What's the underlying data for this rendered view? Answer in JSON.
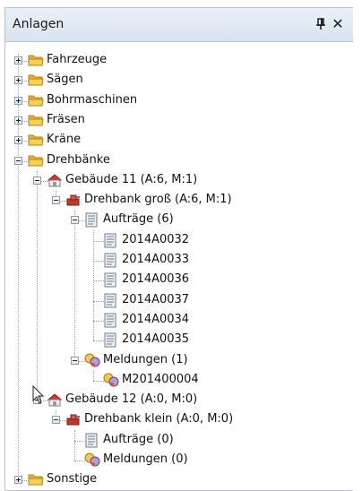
{
  "panel": {
    "title": "Anlagen",
    "pin_icon": "pin-icon",
    "close_icon": "close-icon"
  },
  "tree": {
    "nodes": [
      {
        "label": "Fahrzeuge",
        "type": "folder",
        "expanded": false
      },
      {
        "label": "Sägen",
        "type": "folder",
        "expanded": false
      },
      {
        "label": "Bohrmaschinen",
        "type": "folder",
        "expanded": false
      },
      {
        "label": "Fräsen",
        "type": "folder",
        "expanded": false
      },
      {
        "label": "Kräne",
        "type": "folder",
        "expanded": false
      },
      {
        "label": "Drehbänke",
        "type": "folder",
        "expanded": true
      },
      {
        "label": "Gebäude 11 (A:6, M:1)",
        "type": "building",
        "expanded": true
      },
      {
        "label": "Drehbank groß (A:6, M:1)",
        "type": "machine",
        "expanded": true
      },
      {
        "label": "Aufträge (6)",
        "type": "document",
        "expanded": true
      },
      {
        "label": "2014A0032",
        "type": "document"
      },
      {
        "label": "2014A0033",
        "type": "document"
      },
      {
        "label": "2014A0036",
        "type": "document"
      },
      {
        "label": "2014A0037",
        "type": "document"
      },
      {
        "label": "2014A0034",
        "type": "document"
      },
      {
        "label": "2014A0035",
        "type": "document"
      },
      {
        "label": "Meldungen (1)",
        "type": "message",
        "expanded": true
      },
      {
        "label": "M201400004",
        "type": "message"
      },
      {
        "label": "Gebäude 12 (A:0, M:0)",
        "type": "building",
        "expanded": true
      },
      {
        "label": "Drehbank klein (A:0, M:0)",
        "type": "machine",
        "expanded": true
      },
      {
        "label": "Aufträge (0)",
        "type": "document"
      },
      {
        "label": "Meldungen (0)",
        "type": "message"
      },
      {
        "label": "Sonstige",
        "type": "folder",
        "expanded": false
      }
    ]
  },
  "colors": {
    "title_gradient_top": "#eaf0f7",
    "title_gradient_bottom": "#d9e3ef",
    "folder": "#f5c542",
    "building_roof": "#d23a2a",
    "machine": "#c0392b"
  },
  "cursor_icon": "mouse-pointer-icon"
}
